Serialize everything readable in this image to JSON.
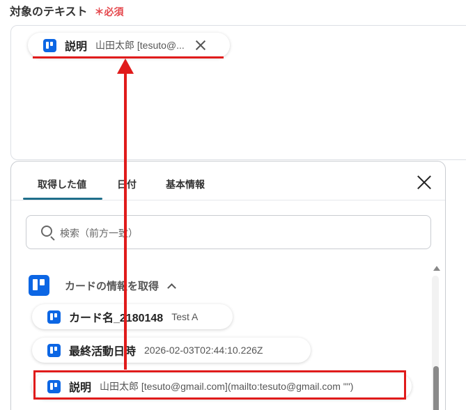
{
  "field": {
    "label": "対象のテキスト",
    "required": "＊必須"
  },
  "selected_chip": {
    "name": "説明",
    "value": "山田太郎 [tesuto@..."
  },
  "panel": {
    "tabs": [
      "取得した値",
      "日付",
      "基本情報"
    ],
    "active_tab": "取得した値",
    "search_placeholder": "検索（前方一致）",
    "group_title": "カードの情報を取得",
    "items": [
      {
        "name": "カード名_2180148",
        "value": "Test A"
      },
      {
        "name": "最終活動日時",
        "value": "2026-02-03T02:44:10.226Z"
      },
      {
        "name": "説明",
        "value": "山田太郎 [tesuto@gmail.com](mailto:tesuto@gmail.com \"\")"
      }
    ]
  },
  "colors": {
    "annotation": "#e01b1b",
    "trello": "#0c66e4",
    "active_tab": "#1f6f8b",
    "required": "#e5484d"
  },
  "icons": [
    "trello-icon",
    "close-icon",
    "search-icon",
    "chevron-up-icon",
    "arrow-up-annotation"
  ]
}
